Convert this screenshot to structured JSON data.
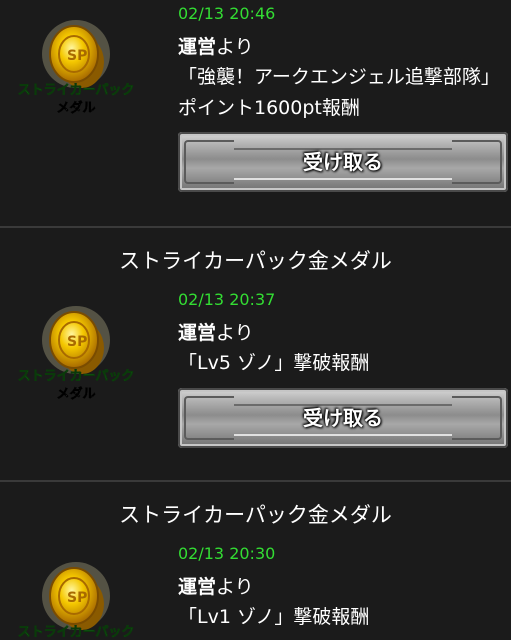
{
  "icon": {
    "name": "striker-pack-medal-icon",
    "line1": "ストライカーパック",
    "line2": "メダル",
    "gold": "#e8b300",
    "green": "#2ecc40"
  },
  "colors": {
    "background": "#1b1b1b",
    "date": "#33dd33",
    "separator": "#3a3a3a"
  },
  "items": [
    {
      "title": "",
      "date": "02/13 20:46",
      "sender_bold": "運営",
      "sender_rest": "より",
      "message": "「強襲！アークエンジェル追撃部隊」ポイント1600pt報酬",
      "button_label": "受け取る"
    },
    {
      "title": "ストライカーパック金メダル",
      "date": "02/13 20:37",
      "sender_bold": "運営",
      "sender_rest": "より",
      "message": "「Lv5 ゾノ」撃破報酬",
      "button_label": "受け取る"
    },
    {
      "title": "ストライカーパック金メダル",
      "date": "02/13 20:30",
      "sender_bold": "運営",
      "sender_rest": "より",
      "message": "「Lv1 ゾノ」撃破報酬",
      "button_label": ""
    }
  ]
}
